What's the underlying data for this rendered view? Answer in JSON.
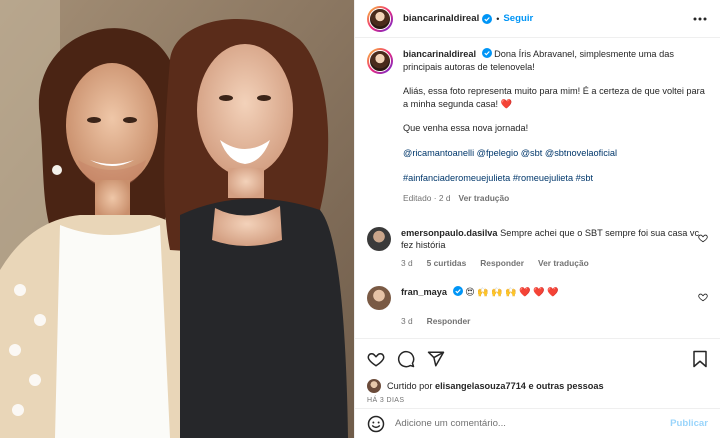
{
  "header": {
    "username": "biancarinaldireal",
    "separator": "•",
    "follow_label": "Seguir",
    "more_icon": "more-icon"
  },
  "caption": {
    "username": "biancarinaldireal",
    "line1": "Dona Íris Abravanel, simplesmente uma das principais autoras de telenovela!",
    "line2": "Aliás, essa foto representa muito para mim! É a certeza de que voltei para a minha segunda casa! ❤️",
    "line3": "Que venha essa nova jornada!",
    "mentions": "@ricamantoanelli @fpelegio @sbt @sbtnovelaoficial",
    "hashtags": "#ainfanciaderomeuejulieta #romeuejulieta #sbt",
    "edited": "Editado · 2 d",
    "see_translation": "Ver tradução"
  },
  "comments": [
    {
      "username": "emersonpaulo.dasilva",
      "text": "Sempre achei que o SBT sempre foi sua casa vc fez história",
      "time": "3 d",
      "likes": "5 curtidas",
      "reply": "Responder",
      "translate": "Ver tradução"
    },
    {
      "username": "fran_maya",
      "text": "😍 🙌 🙌 🙌 ❤️ ❤️ ❤️",
      "time": "3 d",
      "reply": "Responder"
    }
  ],
  "likes": {
    "prefix": "Curtido por",
    "user": "elisangelasouza7714",
    "suffix": "e outras pessoas",
    "ago": "HÁ 3 DIAS"
  },
  "add_comment": {
    "placeholder": "Adicione um comentário...",
    "post_label": "Publicar"
  },
  "colors": {
    "accent": "#0095f6",
    "link": "#00376b",
    "heart": "#ed4956"
  }
}
